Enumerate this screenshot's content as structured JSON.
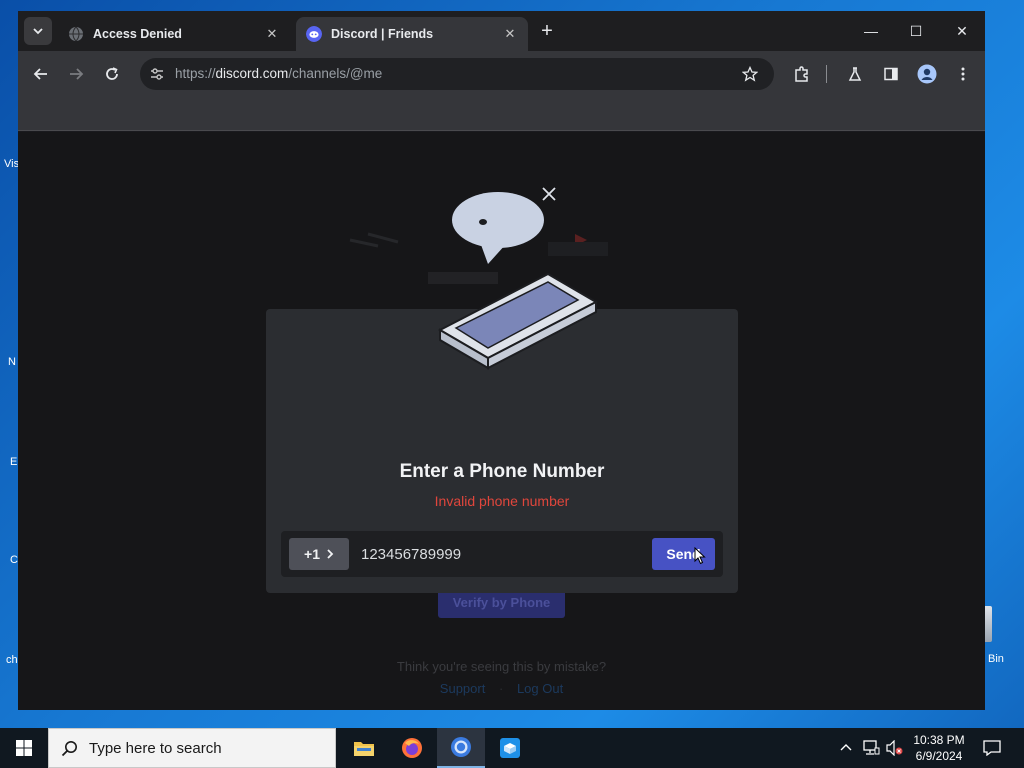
{
  "browser": {
    "tabs": [
      {
        "title": "Access Denied",
        "close": "✕"
      },
      {
        "title": "Discord | Friends",
        "close": "✕"
      }
    ],
    "new_tab": "+",
    "window_controls": {
      "minimize": "—",
      "maximize": "☐",
      "close": "✕"
    },
    "url_prefix": "https://",
    "url_host": "discord.com",
    "url_path": "/channels/@me"
  },
  "page": {
    "background_hint": "Think you're seeing this by mistake?",
    "links": [
      "Support",
      "Log Out"
    ],
    "bg_button": "Verify by Phone"
  },
  "modal": {
    "title": "Enter a Phone Number",
    "error": "Invalid phone number",
    "country_code": "+1",
    "phone_value": "123456789999",
    "send_label": "Send"
  },
  "taskbar": {
    "search_placeholder": "Type here to search",
    "time": "10:38 PM",
    "date": "6/9/2024"
  },
  "desktop": {
    "fragments": [
      "Vis",
      "N",
      "E",
      "C",
      "ch",
      "Bin"
    ]
  },
  "colors": {
    "accent": "#4752c4",
    "error": "#e0463c",
    "modal_bg": "#2b2d31"
  }
}
